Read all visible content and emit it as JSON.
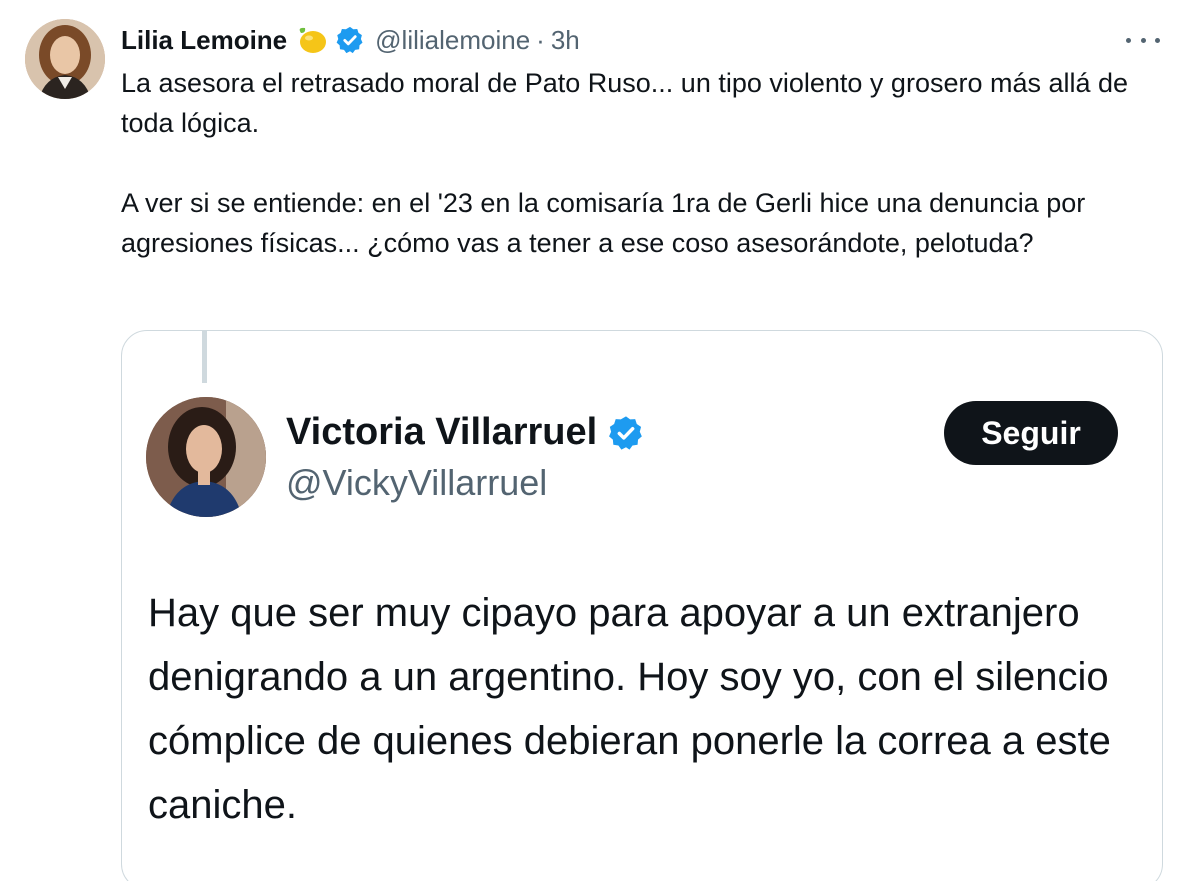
{
  "author": {
    "display_name": "Lilia Lemoine",
    "emoji_name": "lemon-emoji",
    "handle": "@lilialemoine",
    "separator": "·",
    "time": "3h",
    "verified": true
  },
  "tweet": {
    "paragraph_1": "La asesora el retrasado moral de Pato Ruso... un tipo violento y grosero más allá de toda lógica.",
    "paragraph_2": "A ver si se entiende: en el '23 en la comisaría 1ra de Gerli hice una denuncia por agresiones físicas... ¿cómo vas a tener a ese coso asesorándote, pelotuda?"
  },
  "quoted": {
    "display_name": "Victoria Villarruel",
    "handle": "@VickyVillarruel",
    "verified": true,
    "follow_label": "Seguir",
    "text": "Hay que ser muy cipayo para apoyar a un extranjero denigrando a un argentino. Hoy soy yo, con el silencio cómplice de quienes debieran ponerle la correa a este caniche."
  },
  "colors": {
    "verified_blue": "#1d9bf0",
    "text_primary": "#0f1419",
    "text_secondary": "#536471",
    "border": "#cfd9de",
    "button_bg": "#0f1419"
  }
}
